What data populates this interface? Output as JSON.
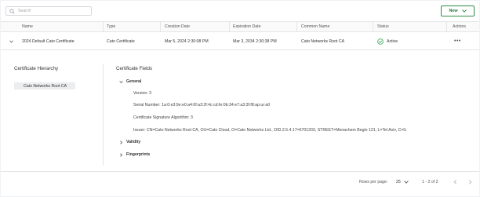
{
  "search": {
    "placeholder": "Search"
  },
  "toolbar": {
    "new_label": "New"
  },
  "table": {
    "columns": [
      "Name",
      "Type",
      "Creation Date",
      "Expiration Date",
      "Common Name",
      "Status",
      "Actions"
    ],
    "rows": [
      {
        "name": "2024 Default Cato Certificate",
        "type": "Cato Certificate",
        "creation_date": "Mar 5, 2024 2:30:08 PM",
        "expiration_date": "Mar 3, 2034 2:30:38 PM",
        "common_name": "Cato Networks Root CA",
        "status": "Active",
        "status_color": "#2e9e4f"
      }
    ]
  },
  "details": {
    "hierarchy_title": "Certificate Hierarchy",
    "hierarchy_item": "Cato Networks Root CA",
    "fields_title": "Certificate Fields",
    "general_label": "General",
    "version": "Version: 3",
    "serial": "Serial Number: 1a:0:e3:9e:e0:a4:0f:a3:2f:4c:cd:fe:0b:34:e7:a3:3f:f8:ap:ur:a0",
    "algorithm": "Certificate Signature Algorithm: 3",
    "issuer": "Issuer: CN=Cato Networks Root CA, OU=Cato Cloud, O=Cato Networks Ltd., OID.2.5.4.17=6701203, STREET=Menachem Begin 121, L=Tel Aviv, C=IL",
    "validity_label": "Validity",
    "fingerprints_label": "Fingerprints"
  },
  "pagination": {
    "rows_per_page_label": "Rows per page:",
    "rows_per_page_value": "25",
    "range": "1 - 2 of 2"
  },
  "colors": {
    "accent": "#2e8b43",
    "active": "#2e9e4f"
  }
}
